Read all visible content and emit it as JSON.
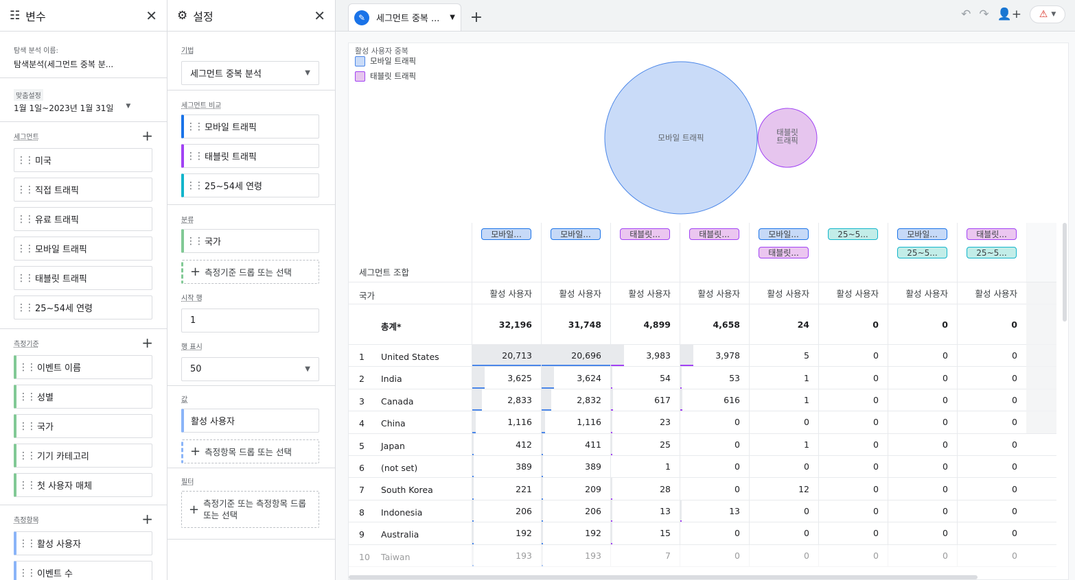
{
  "variables": {
    "title": "변수",
    "exploration_label": "탐색 분석 이름:",
    "exploration_name": "탐색분석(세그먼트 중복 분...",
    "date_label": "맞춤설정",
    "date_range": "1월 1일~2023년 1월 31일",
    "segments_label": "세그먼트",
    "segments": [
      "미국",
      "직접 트래픽",
      "유료 트래픽",
      "모바일 트래픽",
      "태블릿 트래픽",
      "25~54세 연령"
    ],
    "dimensions_label": "측정기준",
    "dimensions": [
      "이벤트 이름",
      "성별",
      "국가",
      "기기 카테고리",
      "첫 사용자 매체"
    ],
    "metrics_label": "측정항목",
    "metrics": [
      "활성 사용자",
      "이벤트 수"
    ]
  },
  "settings": {
    "title": "설정",
    "technique_label": "기법",
    "technique": "세그먼트 중복 분석",
    "segment_compare_label": "세그먼트 비교",
    "segment_compare": [
      "모바일 트래픽",
      "태블릿 트래픽",
      "25~54세 연령"
    ],
    "breakdown_label": "분류",
    "breakdown": "국가",
    "drop_dimension": "측정기준 드롭 또는 선택",
    "start_row_label": "시작 행",
    "start_row": "1",
    "show_rows_label": "행 표시",
    "show_rows": "50",
    "values_label": "값",
    "values": "활성 사용자",
    "drop_metric": "측정항목 드롭 또는 선택",
    "filter_label": "필터",
    "filter_placeholder": "측정기준 또는 측정항목 드롭 또는 선택"
  },
  "tabbar": {
    "tab_label": "세그먼트 중복 ...",
    "add": "+"
  },
  "venn": {
    "title": "활성 사용자 중복",
    "legend": [
      "모바일 트래픽",
      "태블릿 트래픽"
    ],
    "circle_mobile": "모바일 트래픽",
    "circle_tablet_1": "태블릿",
    "circle_tablet_2": "트래픽",
    "colors": {
      "mobile": "#c9dbf8",
      "mobile_stroke": "#4a86e8",
      "tablet": "#e6c5ee",
      "tablet_stroke": "#a142f4"
    }
  },
  "table": {
    "seg_combo_label": "세그먼트 조합",
    "dim_label": "국가",
    "metric_label": "활성 사용자",
    "total_label": "총계*",
    "col_pills": [
      [
        [
          "모바일...",
          "blue"
        ]
      ],
      [
        [
          "모바일...",
          "blue"
        ]
      ],
      [
        [
          "태블릿...",
          "purple"
        ]
      ],
      [
        [
          "태블릿...",
          "purple"
        ]
      ],
      [
        [
          "모바일...",
          "blue"
        ],
        [
          "태블릿...",
          "purple"
        ]
      ],
      [
        [
          "25~5...",
          "teal"
        ]
      ],
      [
        [
          "모바일...",
          "blue"
        ],
        [
          "25~5...",
          "teal"
        ]
      ],
      [
        [
          "태블릿...",
          "purple"
        ],
        [
          "25~5...",
          "teal"
        ]
      ]
    ],
    "totals": [
      "32,196",
      "31,748",
      "4,899",
      "4,658",
      "24",
      "0",
      "0",
      "0"
    ],
    "rows": [
      {
        "n": "1",
        "country": "United States",
        "v": [
          "20,713",
          "20,696",
          "3,983",
          "3,978",
          "5",
          "0",
          "0",
          "0"
        ]
      },
      {
        "n": "2",
        "country": "India",
        "v": [
          "3,625",
          "3,624",
          "54",
          "53",
          "1",
          "0",
          "0",
          "0"
        ]
      },
      {
        "n": "3",
        "country": "Canada",
        "v": [
          "2,833",
          "2,832",
          "617",
          "616",
          "1",
          "0",
          "0",
          "0"
        ]
      },
      {
        "n": "4",
        "country": "China",
        "v": [
          "1,116",
          "1,116",
          "23",
          "0",
          "0",
          "0",
          "0",
          "0"
        ]
      },
      {
        "n": "5",
        "country": "Japan",
        "v": [
          "412",
          "411",
          "25",
          "0",
          "1",
          "0",
          "0",
          "0"
        ]
      },
      {
        "n": "6",
        "country": "(not set)",
        "v": [
          "389",
          "389",
          "1",
          "0",
          "0",
          "0",
          "0",
          "0"
        ]
      },
      {
        "n": "7",
        "country": "South Korea",
        "v": [
          "221",
          "209",
          "28",
          "0",
          "12",
          "0",
          "0",
          "0"
        ]
      },
      {
        "n": "8",
        "country": "Indonesia",
        "v": [
          "206",
          "206",
          "13",
          "13",
          "0",
          "0",
          "0",
          "0"
        ]
      },
      {
        "n": "9",
        "country": "Australia",
        "v": [
          "192",
          "192",
          "15",
          "0",
          "0",
          "0",
          "0",
          "0"
        ]
      },
      {
        "n": "10",
        "country": "Taiwan",
        "v": [
          "193",
          "193",
          "7",
          "0",
          "0",
          "0",
          "0",
          "0"
        ]
      }
    ],
    "bar_fractions": [
      [
        1.0,
        1.0,
        0.19,
        0.19
      ],
      [
        0.175,
        0.175,
        0.003,
        0.003
      ],
      [
        0.137,
        0.137,
        0.03,
        0.03
      ],
      [
        0.054,
        0.054,
        0.001,
        0
      ],
      [
        0.02,
        0.02,
        0.001,
        0
      ],
      [
        0.019,
        0.019,
        0,
        0
      ],
      [
        0.011,
        0.01,
        0.001,
        0
      ],
      [
        0.01,
        0.01,
        0.001,
        0.001
      ],
      [
        0.009,
        0.009,
        0.001,
        0
      ],
      [
        0.009,
        0.009,
        0,
        0
      ]
    ]
  }
}
